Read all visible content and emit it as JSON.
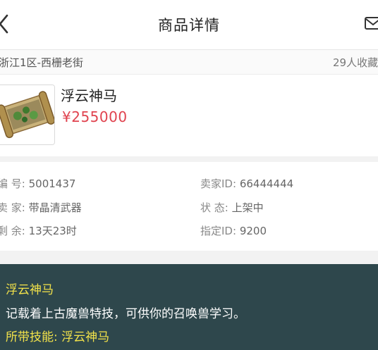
{
  "header": {
    "title": "商品详情"
  },
  "server": {
    "name": "浙江1区-西栅老街",
    "favorites": "29人收藏"
  },
  "item": {
    "name": "浮云神马",
    "price": "¥255000"
  },
  "details": {
    "serial_label": "编 号:",
    "serial_value": "5001437",
    "seller_id_label": "卖家ID:",
    "seller_id_value": "66444444",
    "seller_label": "卖 家:",
    "seller_value": "带晶清武器",
    "status_label": "状 态:",
    "status_value": "上架中",
    "remaining_label": "剩 余:",
    "remaining_value": "13天23时",
    "assigned_id_label": "指定ID:",
    "assigned_id_value": "9200"
  },
  "description": {
    "name": "浮云神马",
    "text": "记载着上古魔兽特技，可供你的召唤兽学习。",
    "skill_label": "所带技能:",
    "skill_value": "浮云神马"
  },
  "colors": {
    "price": "#e0434f",
    "panel": "#2e474c",
    "highlight": "#f2e24a"
  }
}
